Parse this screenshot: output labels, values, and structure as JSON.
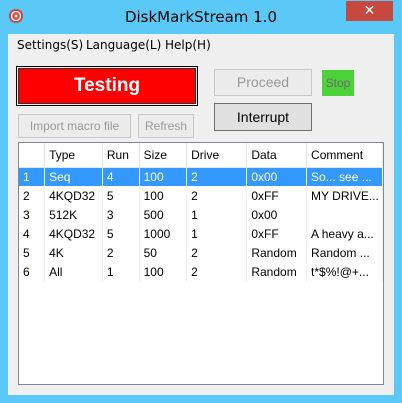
{
  "window": {
    "title": "DiskMarkStream 1.0",
    "close_label": "✕"
  },
  "menu": [
    {
      "label": "Settings(S)"
    },
    {
      "label": "Language(L)"
    },
    {
      "label": "Help(H)"
    }
  ],
  "controls": {
    "testing_label": "Testing",
    "proceed_label": "Proceed",
    "stop_label": "Stop",
    "interrupt_label": "Interrupt",
    "import_label": "Import macro file",
    "refresh_label": "Refresh"
  },
  "colors": {
    "testing_bg": "#ff0000",
    "stop_bg": "#4cd33a",
    "selection": "#3399ff",
    "titlebar": "#5bc9f7",
    "close": "#c7483e"
  },
  "table": {
    "columns": [
      "",
      "Type",
      "Run",
      "Size",
      "Drive",
      "Data",
      "Comment"
    ],
    "rows": [
      [
        "1",
        "Seq",
        "4",
        "100",
        "2",
        "0x00",
        "So... see ..."
      ],
      [
        "2",
        "4KQD32",
        "5",
        "100",
        "2",
        "0xFF",
        "MY DRIVE..."
      ],
      [
        "3",
        "512K",
        "3",
        "500",
        "1",
        "0x00",
        ""
      ],
      [
        "4",
        "4KQD32",
        "5",
        "1000",
        "1",
        "0xFF",
        "A heavy a..."
      ],
      [
        "5",
        "4K",
        "2",
        "50",
        "2",
        "Random",
        "Random ..."
      ],
      [
        "6",
        "All",
        "1",
        "100",
        "2",
        "Random",
        "t*$%!@+..."
      ]
    ],
    "selected_row": 0
  }
}
